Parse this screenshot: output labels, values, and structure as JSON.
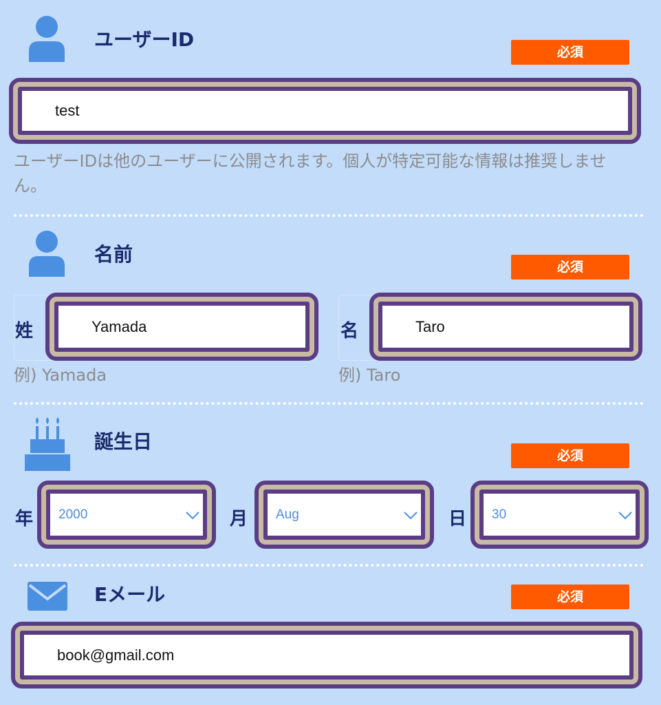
{
  "badge_required": "必須",
  "user_id": {
    "title": "ユーザーID",
    "value": "test",
    "hint": "ユーザーIDは他のユーザーに公開されます。個人が特定可能な情報は推奨しません。"
  },
  "name": {
    "title": "名前",
    "last_label": "姓",
    "last_value": "Yamada",
    "last_hint": "例) Yamada",
    "first_label": "名",
    "first_value": "Taro",
    "first_hint": "例) Taro"
  },
  "birthday": {
    "title": "誕生日",
    "year_label": "年",
    "year_value": "2000",
    "month_label": "月",
    "month_value": "Aug",
    "day_label": "日",
    "day_value": "30"
  },
  "email": {
    "title": "Eメール",
    "value": "book@gmail.com"
  },
  "colors": {
    "background": "#c2dcfa",
    "badge": "#ff5a00",
    "title": "#1a2a6c",
    "icon": "#4a8fe0",
    "frame_outer": "#5b3d86",
    "frame_middle": "#c8bba6"
  },
  "icons": [
    "person-icon",
    "person-icon",
    "birthday-cake-icon",
    "envelope-icon",
    "chevron-down-icon"
  ]
}
